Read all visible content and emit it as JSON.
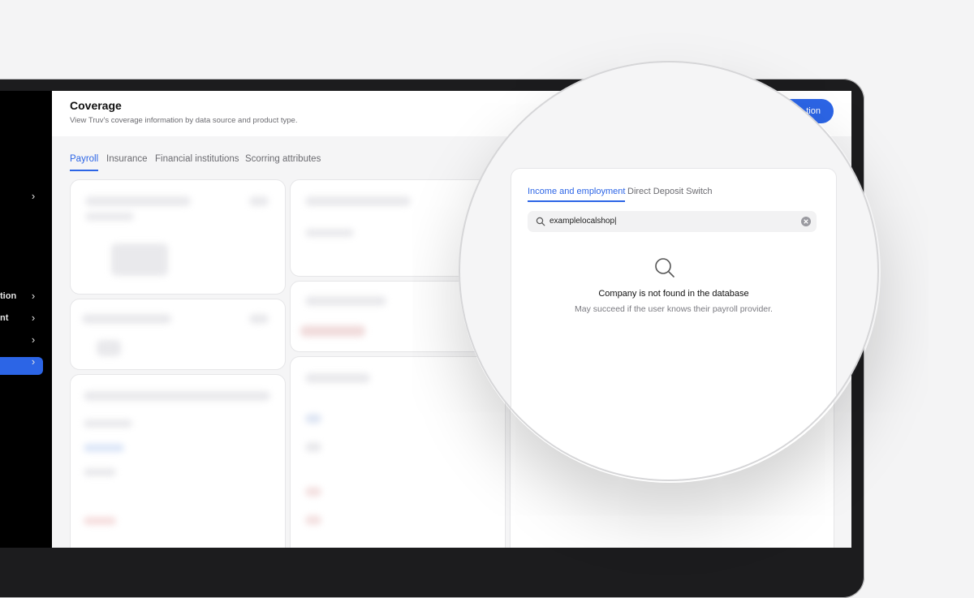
{
  "sidebar": {
    "items": [
      {
        "label": "",
        "has_chevron": true
      },
      {
        "label": "tion",
        "has_chevron": true
      },
      {
        "label": "nt",
        "has_chevron": true
      },
      {
        "label": "",
        "has_chevron": true
      },
      {
        "label": "",
        "has_chevron": true
      }
    ],
    "chevron_glyph": "›"
  },
  "header": {
    "title": "Coverage",
    "subtitle": "View Truv's coverage information by data source and product type.",
    "primary_button_label": "tion"
  },
  "tabs": [
    {
      "label": "Payroll",
      "active": true
    },
    {
      "label": "Insurance",
      "active": false
    },
    {
      "label": "Financial institutions",
      "active": false
    },
    {
      "label": "Scorring attributes",
      "active": false
    }
  ],
  "panel": {
    "tabs": [
      {
        "label": "Income and employment",
        "active": true
      },
      {
        "label": "Direct Deposit Switch",
        "active": false
      }
    ],
    "search": {
      "value": "examplelocalshop|",
      "icon": "search-icon",
      "clear_icon": "clear-circle-icon"
    },
    "empty_state": {
      "icon": "magnifier-icon",
      "title": "Company is not found in the database",
      "subtitle": "May succeed if the user knows their payroll provider."
    }
  },
  "colors": {
    "accent": "#2c65e6",
    "sidebar_bg": "#000000",
    "page_bg": "#f5f5f6"
  }
}
